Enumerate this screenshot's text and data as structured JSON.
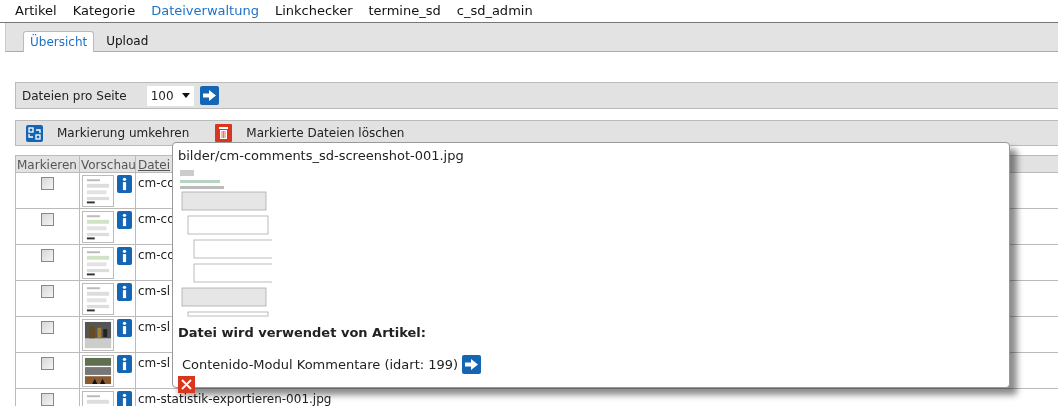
{
  "nav": [
    {
      "label": "Artikel",
      "selected": false
    },
    {
      "label": "Kategorie",
      "selected": false
    },
    {
      "label": "Dateiverwaltung",
      "selected": true
    },
    {
      "label": "Linkchecker",
      "selected": false
    },
    {
      "label": "termine_sd",
      "selected": false
    },
    {
      "label": "c_sd_admin",
      "selected": false
    }
  ],
  "tabs": [
    {
      "label": "Übersicht",
      "selected": true
    },
    {
      "label": "Upload",
      "selected": false
    }
  ],
  "pagination": {
    "label": "Dateien pro Seite",
    "value": "100"
  },
  "actions": [
    {
      "kind": "invert",
      "label": "Markierung umkehren"
    },
    {
      "kind": "delete",
      "label": "Markierte Dateien löschen"
    }
  ],
  "table": {
    "columns": [
      "Markieren",
      "Vorschau",
      "Datei"
    ],
    "rows": [
      {
        "checked": false,
        "file": "cm-co"
      },
      {
        "checked": false,
        "file": "cm-co"
      },
      {
        "checked": false,
        "file": "cm-co"
      },
      {
        "checked": false,
        "file": "cm-sl"
      },
      {
        "checked": false,
        "file": "cm-sl"
      },
      {
        "checked": false,
        "file": "cm-sl"
      },
      {
        "checked": false,
        "file": "cm-statistik-exportieren-001.jpg"
      }
    ]
  },
  "popup": {
    "path": "bilder/cm-comments_sd-screenshot-001.jpg",
    "heading": "Datei wird verwendet von Artikel:",
    "usages": [
      {
        "title": "Contenido-Modul Kommentare (idart: 199)"
      }
    ]
  }
}
